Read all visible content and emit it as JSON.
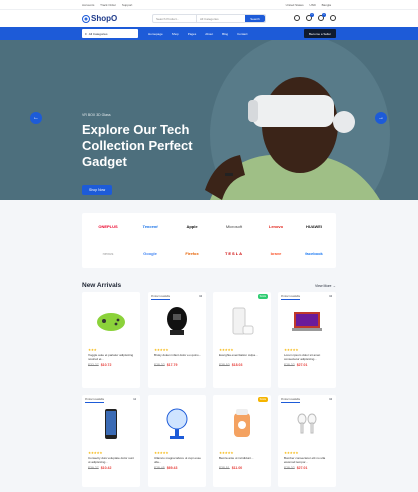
{
  "topbar": {
    "links": [
      "Accounts",
      "Track Order",
      "Support"
    ],
    "right": [
      "United States",
      "USD",
      "Bangla"
    ]
  },
  "header": {
    "logo": "ShopO",
    "search_placeholder": "Search Product...",
    "category_placeholder": "All Categories",
    "search_button": "Search",
    "cart_count": "0",
    "wishlist_count": "0"
  },
  "nav": {
    "all_categories": "All Categories",
    "links": [
      "Homepage",
      "Shop",
      "Pages",
      "About",
      "Blog",
      "Contact"
    ],
    "seller_button": "Become a Seller"
  },
  "hero": {
    "kicker": "VR BOX 3D Glass",
    "title": "Explore Our Tech Collection Perfect Gadget",
    "cta": "Shop Now"
  },
  "brands": [
    "ONEPLUS",
    "Tencent",
    "Apple",
    "Microsoft",
    "Lenovo",
    "HUAWEI",
    "nexus",
    "Google",
    "Firefox",
    "TESLA",
    "brave",
    "facebook"
  ],
  "new_arrivals": {
    "title": "New Arrivals",
    "view_more": "View More",
    "products": [
      {
        "name": "Xoggle aute et pariatur adipisicing nostrud et...",
        "old": "$32.27",
        "new": "$10.72",
        "tag": "",
        "badge": "",
        "rating": "★★★"
      },
      {
        "name": "Broky doken infant dolor eu quino...",
        "old": "$28.32",
        "new": "$17.79",
        "tag": "Product available",
        "badge": "",
        "rating": "★★★★★"
      },
      {
        "name": "Exerghia exercitation culpa...",
        "old": "$38.53",
        "new": "$18.03",
        "tag": "",
        "badge": "SALE",
        "rating": "★★★★★"
      },
      {
        "name": "Lorem ipsum dolor sit amet consectetur adipisicing...",
        "old": "$28.32",
        "new": "$27.01",
        "tag": "Product available",
        "badge": "",
        "rating": "★★★★★"
      },
      {
        "name": "Consecty duis voluptate dolor sunt ut adipisicing...",
        "old": "$39.27",
        "new": "$10.42",
        "tag": "Product available",
        "badge": "",
        "rating": "★★★★★"
      },
      {
        "name": "Ullamco magna labore ut cupi esse ulla...",
        "old": "$28.45",
        "new": "$69.43",
        "tag": "",
        "badge": "",
        "rating": "★★★★★"
      },
      {
        "name": "Bemla ante ut incididunt...",
        "old": "$38.51",
        "new": "$11.00",
        "tag": "",
        "badge": "SALE",
        "rating": "★★★★★"
      },
      {
        "name": "Bomber consectetur elit no ulla eiusmod tempor...",
        "old": "$28.32",
        "new": "$27.01",
        "tag": "Product available",
        "badge": "",
        "rating": "★★★★★"
      }
    ]
  },
  "colors": {
    "brand": "#1d5bd8",
    "hero_bg": "#4d6f7d",
    "price": "#e53935"
  }
}
